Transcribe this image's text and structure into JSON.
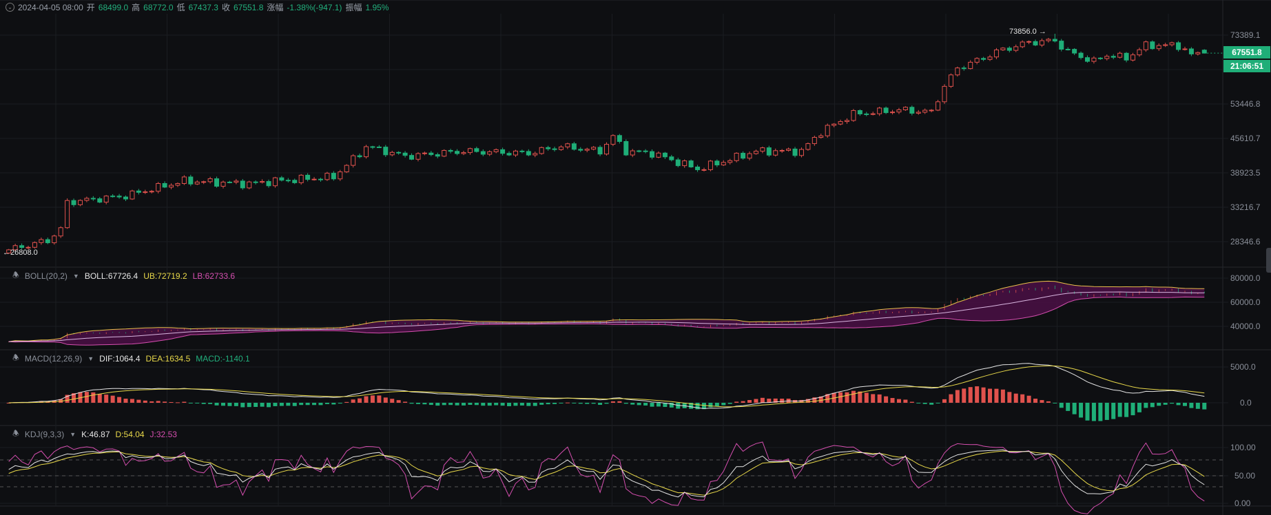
{
  "header": {
    "datetime": "2024-04-05 08:00",
    "open_label": "开",
    "open": "68499.0",
    "high_label": "高",
    "high": "68772.0",
    "low_label": "低",
    "low": "67437.3",
    "close_label": "收",
    "close": "67551.8",
    "change_label": "涨幅",
    "change": "-1.38%(-947.1)",
    "amp_label": "振幅",
    "amp": "1.95%"
  },
  "price_axis": [
    "73389.1",
    "53446.8",
    "45610.7",
    "38923.5",
    "33216.7",
    "28346.6"
  ],
  "current_price": "67551.8",
  "countdown": "21:06:51",
  "annotations": {
    "max": "73856.0 →",
    "min": "←26808.0"
  },
  "boll": {
    "name": "BOLL(20,2)",
    "boll": "BOLL:67726.4",
    "ub": "UB:72719.2",
    "lb": "LB:62733.6",
    "axis": [
      "80000.0",
      "60000.0",
      "40000.0"
    ]
  },
  "macd": {
    "name": "MACD(12,26,9)",
    "dif": "DIF:1064.4",
    "dea": "DEA:1634.5",
    "macd": "MACD:-1140.1",
    "axis": [
      "5000.0",
      "0.0"
    ]
  },
  "kdj": {
    "name": "KDJ(9,3,3)",
    "k": "K:46.87",
    "d": "D:54.04",
    "j": "J:32.53",
    "axis": [
      "100.00",
      "50.00",
      "0.00"
    ]
  },
  "colors": {
    "up": "#e0524d",
    "down": "#1fae78",
    "bg": "#0e0f12"
  },
  "chart_data": {
    "type": "candlestick",
    "scale": "log",
    "candles": 185,
    "trend_keypoints": [
      [
        0,
        27300
      ],
      [
        6,
        28500
      ],
      [
        8,
        30000
      ],
      [
        9,
        34000
      ],
      [
        18,
        35000
      ],
      [
        27,
        37500
      ],
      [
        37,
        37000
      ],
      [
        41,
        37500
      ],
      [
        50,
        38200
      ],
      [
        54,
        42500
      ],
      [
        55,
        44000
      ],
      [
        61,
        42000
      ],
      [
        70,
        43000
      ],
      [
        80,
        42600
      ],
      [
        85,
        44000
      ],
      [
        91,
        43000
      ],
      [
        93,
        46000
      ],
      [
        95,
        43000
      ],
      [
        99,
        42600
      ],
      [
        106,
        39600
      ],
      [
        110,
        41000
      ],
      [
        115,
        43000
      ],
      [
        122,
        43000
      ],
      [
        125,
        47000
      ],
      [
        130,
        51000
      ],
      [
        137,
        52000
      ],
      [
        142,
        51500
      ],
      [
        144,
        58000
      ],
      [
        146,
        63000
      ],
      [
        150,
        66000
      ],
      [
        152,
        68000
      ],
      [
        157,
        71000
      ],
      [
        161,
        71500
      ],
      [
        163,
        68000
      ],
      [
        167,
        65000
      ],
      [
        169,
        67000
      ],
      [
        172,
        66000
      ],
      [
        175,
        70000
      ],
      [
        180,
        70000
      ],
      [
        182,
        67000
      ],
      [
        184,
        67551.8
      ]
    ],
    "last": {
      "open": 68499.0,
      "high": 68772.0,
      "low": 67437.3,
      "close": 67551.8
    },
    "max": 73856.0,
    "min": 26808.0
  }
}
